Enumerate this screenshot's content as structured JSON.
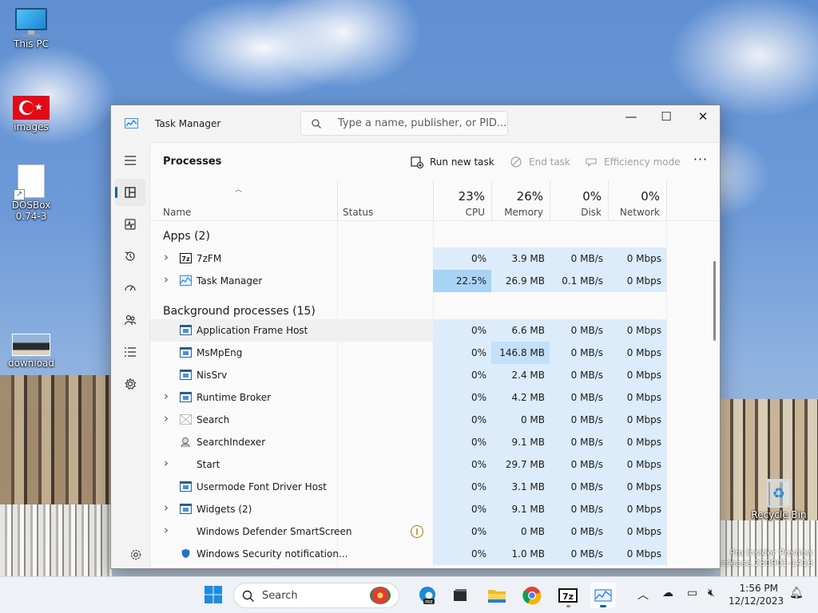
{
  "desktop": {
    "icons": [
      {
        "label": "This PC"
      },
      {
        "label": "images"
      },
      {
        "label": "DOSBox\n0.74-3"
      },
      {
        "label": "download"
      },
      {
        "label": "Recycle Bin"
      }
    ],
    "watermark_line1": "Pro Insider Preview",
    "watermark_line2": "prerelease.230901-1416"
  },
  "window": {
    "title": "Task Manager",
    "search_placeholder": "Type a name, publisher, or PID...",
    "caption": {
      "minimize": "—",
      "maximize": "☐",
      "close": "✕"
    }
  },
  "nav": [
    {
      "icon": "processes-icon",
      "active": true
    },
    {
      "icon": "performance-icon"
    },
    {
      "icon": "app-history-icon"
    },
    {
      "icon": "startup-apps-icon"
    },
    {
      "icon": "users-icon"
    },
    {
      "icon": "details-icon"
    },
    {
      "icon": "services-icon"
    },
    {
      "icon": "settings-icon"
    }
  ],
  "commandbar": {
    "page_title": "Processes",
    "run_new_task": "Run new task",
    "end_task": "End task",
    "efficiency_mode": "Efficiency mode",
    "more": "···"
  },
  "columns": {
    "name": "Name",
    "status": "Status",
    "cpu": {
      "percent": "23%",
      "label": "CPU"
    },
    "memory": {
      "percent": "26%",
      "label": "Memory"
    },
    "disk": {
      "percent": "0%",
      "label": "Disk"
    },
    "network": {
      "percent": "0%",
      "label": "Network"
    }
  },
  "groups": {
    "apps": "Apps (2)",
    "background": "Background processes (15)"
  },
  "apps": [
    {
      "name": "7zFM",
      "expandable": true,
      "icon": "7zip-icon",
      "cpu": "0%",
      "mem": "3.9 MB",
      "disk": "0 MB/s",
      "net": "0 Mbps"
    },
    {
      "name": "Task Manager",
      "expandable": true,
      "icon": "task-manager-icon",
      "cpu": "22.5%",
      "mem": "26.9 MB",
      "disk": "0.1 MB/s",
      "net": "0 Mbps"
    }
  ],
  "background": [
    {
      "name": "Application Frame Host",
      "expandable": false,
      "icon": "process-icon",
      "cpu": "0%",
      "mem": "6.6 MB",
      "disk": "0 MB/s",
      "net": "0 Mbps"
    },
    {
      "name": "MsMpEng",
      "expandable": false,
      "icon": "process-icon",
      "cpu": "0%",
      "mem": "146.8 MB",
      "disk": "0 MB/s",
      "net": "0 Mbps"
    },
    {
      "name": "NisSrv",
      "expandable": false,
      "icon": "process-icon",
      "cpu": "0%",
      "mem": "2.4 MB",
      "disk": "0 MB/s",
      "net": "0 Mbps"
    },
    {
      "name": "Runtime Broker",
      "expandable": true,
      "icon": "process-icon",
      "cpu": "0%",
      "mem": "4.2 MB",
      "disk": "0 MB/s",
      "net": "0 Mbps"
    },
    {
      "name": "Search",
      "expandable": true,
      "icon": "search-app-icon",
      "cpu": "0%",
      "mem": "0 MB",
      "disk": "0 MB/s",
      "net": "0 Mbps"
    },
    {
      "name": "SearchIndexer",
      "expandable": false,
      "icon": "search-indexer-icon",
      "cpu": "0%",
      "mem": "9.1 MB",
      "disk": "0 MB/s",
      "net": "0 Mbps"
    },
    {
      "name": "Start",
      "expandable": true,
      "icon": "none",
      "cpu": "0%",
      "mem": "29.7 MB",
      "disk": "0 MB/s",
      "net": "0 Mbps"
    },
    {
      "name": "Usermode Font Driver Host",
      "expandable": false,
      "icon": "process-icon",
      "cpu": "0%",
      "mem": "3.1 MB",
      "disk": "0 MB/s",
      "net": "0 Mbps"
    },
    {
      "name": "Widgets (2)",
      "expandable": true,
      "icon": "process-icon",
      "cpu": "0%",
      "mem": "9.1 MB",
      "disk": "0 MB/s",
      "net": "0 Mbps"
    },
    {
      "name": "Windows Defender SmartScreen",
      "expandable": true,
      "icon": "none",
      "status": "suspended",
      "cpu": "0%",
      "mem": "0 MB",
      "disk": "0 MB/s",
      "net": "0 Mbps"
    },
    {
      "name": "Windows Security notification...",
      "expandable": false,
      "icon": "shield-icon",
      "cpu": "0%",
      "mem": "1.0 MB",
      "disk": "0 MB/s",
      "net": "0 Mbps"
    }
  ],
  "taskbar": {
    "search_label": "Search",
    "time": "1:56 PM",
    "date": "12/12/2023"
  },
  "colors": {
    "heat_light": "#dcecfb",
    "heat_mid": "#c2e0f8",
    "heat_high": "#a9d3f5",
    "accent": "#005fb8"
  }
}
